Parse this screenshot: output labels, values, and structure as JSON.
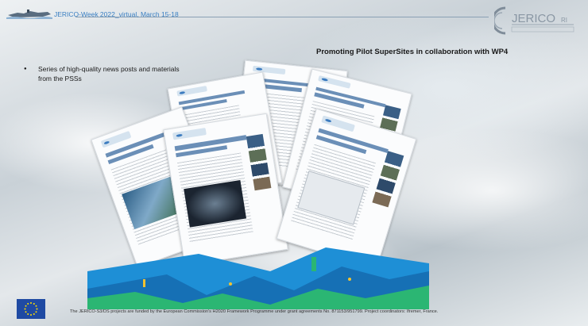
{
  "header": {
    "title": "JERICO-Week 2022_virtual, March 15-18",
    "logo_text": "JERICO RI"
  },
  "main": {
    "headline": "Promoting Pilot SuperSites in collaboration with WP4",
    "bullets": [
      "Series of high-quality news posts and materials from the PSSs"
    ]
  },
  "footer": {
    "funding_text": "The JERICO-S3/DS projects are funded by the European Commission's H2020 Framework Programme under grant agreements No. 871153/951799. Project coordinators: Ifremer, France."
  },
  "colors": {
    "header_text": "#3a7fc2",
    "eu_blue": "#1f4aa3",
    "eu_star": "#ffdd00",
    "ocean": "#1e8fd6",
    "seafloor": "#2bb673"
  }
}
